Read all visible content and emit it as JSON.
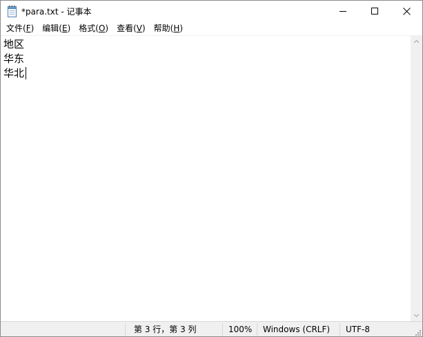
{
  "window": {
    "title": "*para.txt - 记事本"
  },
  "menu": {
    "items": [
      {
        "label": "文件(",
        "accel": "F",
        "tail": ")"
      },
      {
        "label": "编辑(",
        "accel": "E",
        "tail": ")"
      },
      {
        "label": "格式(",
        "accel": "O",
        "tail": ")"
      },
      {
        "label": "查看(",
        "accel": "V",
        "tail": ")"
      },
      {
        "label": "帮助(",
        "accel": "H",
        "tail": ")"
      }
    ]
  },
  "editor": {
    "lines": [
      "地区",
      "华东",
      "华北"
    ]
  },
  "status": {
    "position": "第 3 行，第 3 列",
    "zoom": "100%",
    "line_ending": "Windows (CRLF)",
    "encoding": "UTF-8"
  },
  "icons": {
    "app": "notepad-icon",
    "minimize": "minimize-icon",
    "maximize": "maximize-icon",
    "close": "close-icon"
  }
}
